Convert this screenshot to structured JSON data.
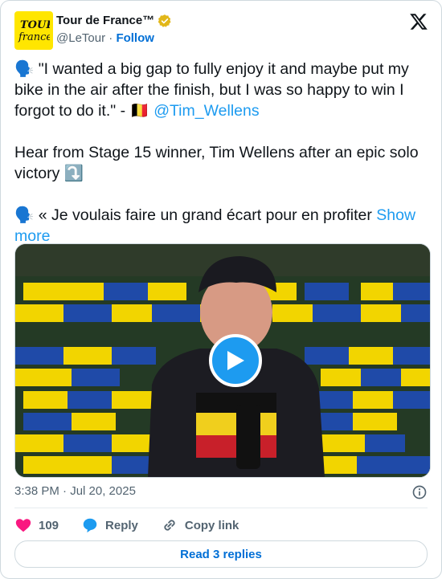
{
  "account": {
    "display_name": "Tour de France™",
    "handle": "@LeTour",
    "separator": "·",
    "follow_label": "Follow"
  },
  "tweet": {
    "line1_prefix": "🗣️ \"I wanted a big gap to fully enjoy it and maybe put my bike in the air after the finish, but I was so happy to win I forgot to do it.\" - 🇧🇪 ",
    "mention": "@Tim_Wellens",
    "paragraph2": "Hear from Stage 15 winner, Tim Wellens after an epic solo victory ⤵️",
    "paragraph3": "🗣️ « Je voulais faire un grand écart pour en profiter ",
    "show_more": "Show more"
  },
  "media": {
    "type": "video",
    "play_icon": "play-icon"
  },
  "meta": {
    "timestamp": "3:38 PM · Jul 20, 2025"
  },
  "actions": {
    "like_count": "109",
    "reply_label": "Reply",
    "copy_label": "Copy link"
  },
  "footer": {
    "read_replies": "Read 3 replies"
  },
  "colors": {
    "accent": "#1d9bf0",
    "link_dark": "#006fd6",
    "like": "#f91880",
    "muted": "#536471",
    "brand_yellow": "#ffe600"
  }
}
